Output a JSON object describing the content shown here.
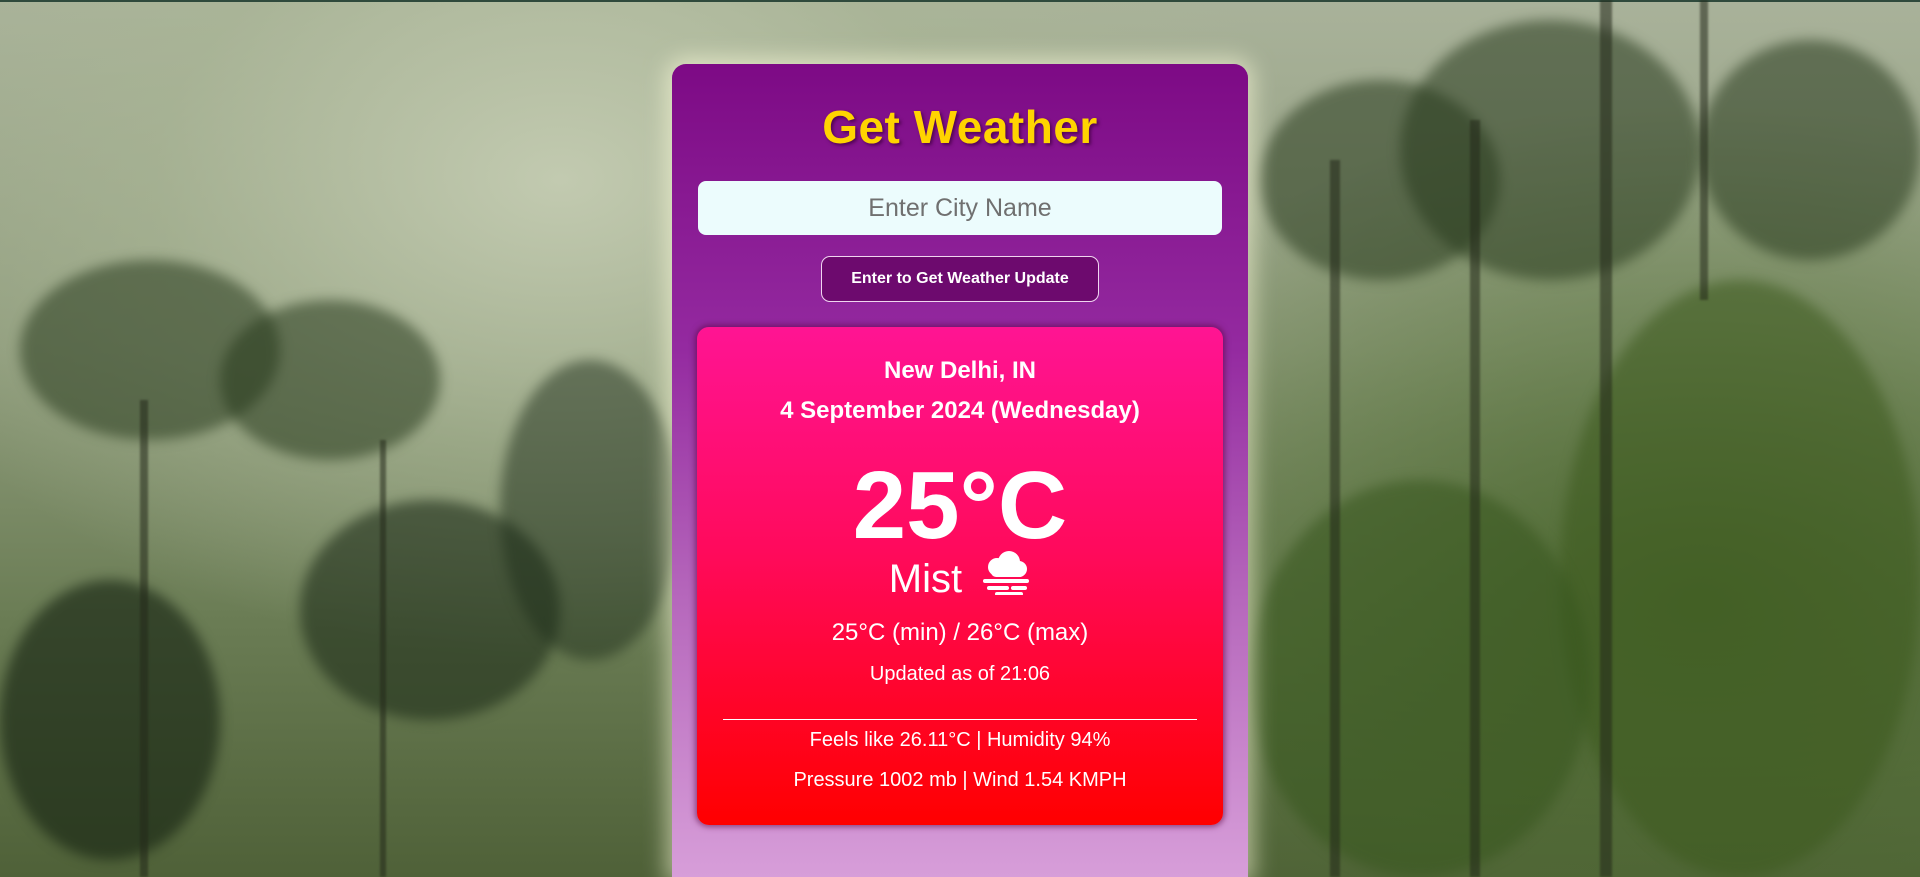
{
  "app": {
    "title": "Get Weather"
  },
  "search": {
    "placeholder": "Enter City Name",
    "value": "",
    "button_label": "Enter to Get Weather Update"
  },
  "weather": {
    "location": "New Delhi, IN",
    "date": "4 September 2024 (Wednesday)",
    "temperature": "25°C",
    "condition": "Mist",
    "condition_icon": "mist-icon",
    "min_max": "25°C (min) / 26°C (max)",
    "updated": "Updated as of 21:06",
    "feels_humidity": "Feels like 26.11°C | Humidity 94%",
    "pressure_wind": "Pressure 1002 mb | Wind 1.54 KMPH"
  },
  "colors": {
    "title": "#ffd400",
    "panel_top": "#7d0a85",
    "panel_bottom": "#d79ed9",
    "card_top": "#ff1493",
    "card_bottom": "#ff0000",
    "button": "#6d0a6e",
    "input_bg": "#ecfcfd"
  }
}
